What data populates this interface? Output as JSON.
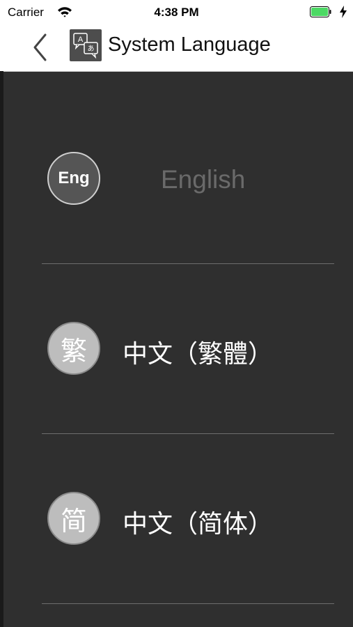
{
  "status_bar": {
    "carrier": "Carrier",
    "time": "4:38 PM",
    "battery_color": "#4cd964"
  },
  "nav": {
    "title": "System Language",
    "back_icon": "chevron-left-icon",
    "title_icon": "translate-icon"
  },
  "languages": [
    {
      "badge": "Eng",
      "label": "English",
      "selected": true
    },
    {
      "badge": "繁",
      "label": "中文（繁體）",
      "selected": false
    },
    {
      "badge": "简",
      "label": "中文（简体）",
      "selected": false
    }
  ],
  "colors": {
    "background": "#2f2f2f",
    "selected_badge": "#555555",
    "unselected_badge": "#bdbdbd",
    "selected_text": "#6a6a6a",
    "unselected_text": "#ffffff"
  }
}
